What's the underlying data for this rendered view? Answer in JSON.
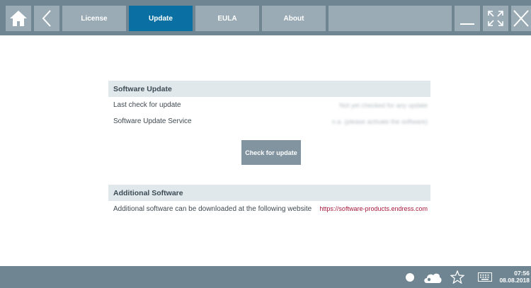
{
  "tabs": [
    {
      "label": "License",
      "active": false
    },
    {
      "label": "Update",
      "active": true
    },
    {
      "label": "EULA",
      "active": false
    },
    {
      "label": "About",
      "active": false
    }
  ],
  "software_update": {
    "title": "Software Update",
    "last_check_label": "Last check for update",
    "last_check_value": "Not yet checked for any update",
    "service_label": "Software Update Service",
    "service_value": "n.a. (please activate the software)",
    "check_button": "Check for update"
  },
  "additional_software": {
    "title": "Additional Software",
    "text": "Additional software can be downloaded at  the following website",
    "link": "https://software-products.endress.com"
  },
  "taskbar": {
    "time": "07:56",
    "date": "08.08.2018",
    "icons": [
      "circle-icon",
      "cloud-icon",
      "star-icon",
      "keyboard-icon"
    ]
  },
  "colors": {
    "bar": "#6f8592",
    "tab": "#9aabb5",
    "active_tab": "#0a70a3",
    "link": "#a6193c"
  }
}
